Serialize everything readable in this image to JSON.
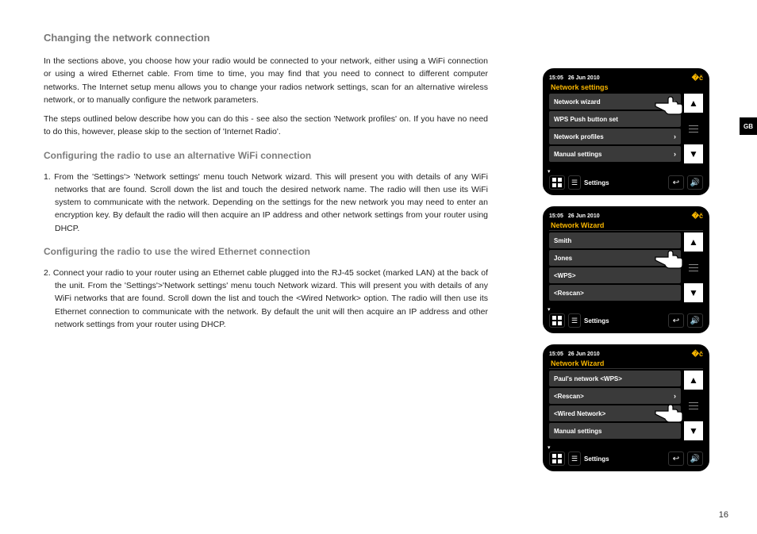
{
  "page": {
    "number": "16",
    "side_tab": "GB"
  },
  "headings": {
    "h1": "Changing the network connection",
    "h2": "Configuring the radio to use an alternative WiFi connection",
    "h3": "Configuring the radio to use the wired Ethernet connection"
  },
  "paragraphs": {
    "p1": "In the sections above, you choose how your radio would be connected to your network, either using a WiFi connection or using a wired Ethernet cable. From time to time, you may find that you need to connect to different computer networks. The Internet setup menu allows you to change your radios network settings, scan for an alternative wireless network, or to manually configure the network parameters.",
    "p2": "The steps outlined below describe how you can do this - see also the section 'Network profiles' on. If you have no need to do this, however, please skip to the section of 'Internet Radio'.",
    "li1": "1. From the 'Settings'> 'Network settings' menu touch Network wizard. This will present you with details of any WiFi networks that are found. Scroll down the list and touch the desired network name. The radio will then use its WiFi system to communicate with the network. Depending on the settings for the new network you may need to enter an encryption key. By default the radio will then acquire an IP address and other network settings from your router using DHCP.",
    "li2": "2. Connect your radio to your router using an Ethernet cable plugged into the RJ-45 socket (marked LAN) at the back of the unit. From the 'Settings'>'Network settings' menu touch Network wizard. This will present you with details of any WiFi networks that are found. Scroll down the list and touch the <Wired Network> option. The radio will then use its Ethernet connection to communicate with the network. By default the unit will then acquire an IP address and other network settings from your router using DHCP."
  },
  "screens": {
    "time": "15:05",
    "date": "26 Jun 2010",
    "bottom_label": "Settings",
    "s1": {
      "title": "Network settings",
      "items": [
        "Network wizard",
        "WPS Push button set",
        "Network profiles",
        "Manual settings"
      ],
      "chev": [
        true,
        false,
        true,
        true
      ]
    },
    "s2": {
      "title": "Network Wizard",
      "items": [
        "Smith",
        "Jones",
        "<WPS>",
        "<Rescan>"
      ],
      "chev": [
        false,
        true,
        false,
        false
      ]
    },
    "s3": {
      "title": "Network Wizard",
      "items": [
        "Paul's network <WPS>",
        "<Rescan>",
        "<Wired Network>",
        "Manual settings"
      ],
      "chev": [
        false,
        true,
        false,
        false
      ]
    }
  }
}
